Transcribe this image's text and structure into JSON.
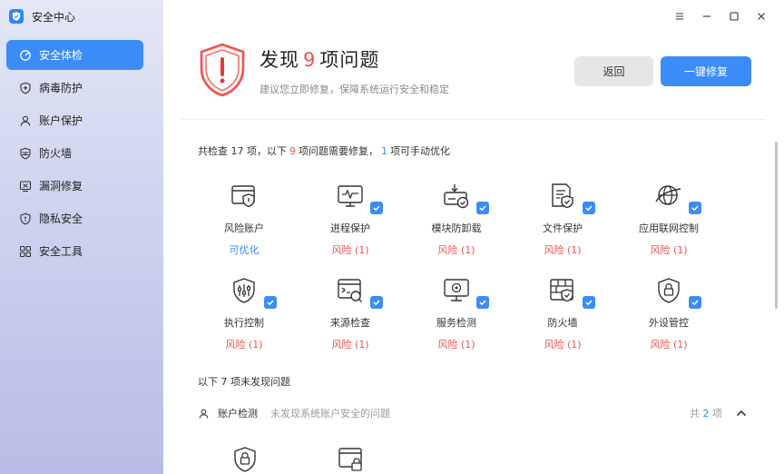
{
  "app": {
    "title": "安全中心"
  },
  "sidebar": {
    "items": [
      {
        "label": "安全体检",
        "icon": "scan-icon",
        "active": true
      },
      {
        "label": "病毒防护",
        "icon": "shield-plus-icon",
        "active": false
      },
      {
        "label": "账户保护",
        "icon": "user-icon",
        "active": false
      },
      {
        "label": "防火墙",
        "icon": "firewall-icon",
        "active": false
      },
      {
        "label": "漏洞修复",
        "icon": "bug-fix-icon",
        "active": false
      },
      {
        "label": "隐私安全",
        "icon": "privacy-shield-icon",
        "active": false
      },
      {
        "label": "安全工具",
        "icon": "tools-grid-icon",
        "active": false
      }
    ]
  },
  "window": {
    "menu": "menu-icon",
    "minimize": "minimize-icon",
    "maximize": "maximize-icon",
    "close": "close-icon"
  },
  "hero": {
    "prefix": "发现",
    "count": "9",
    "suffix": "项问题",
    "subtitle": "建议您立即修复，保障系统运行安全和稳定",
    "back_label": "返回",
    "fix_label": "一键修复"
  },
  "summary": {
    "part1": "共检查 17 项，以下",
    "issues": "9",
    "part2": "项问题需要修复，",
    "manual": "1",
    "part3": "项可手动优化"
  },
  "checks": [
    {
      "name": "风险账户",
      "status": "可优化",
      "status_type": "opt",
      "checked": false,
      "icon": "account-risk-icon"
    },
    {
      "name": "进程保护",
      "status": "风险 (1)",
      "status_type": "risk",
      "checked": true,
      "icon": "process-monitor-icon"
    },
    {
      "name": "模块防卸载",
      "status": "风险 (1)",
      "status_type": "risk",
      "checked": true,
      "icon": "module-uninstall-icon"
    },
    {
      "name": "文件保护",
      "status": "风险 (1)",
      "status_type": "risk",
      "checked": true,
      "icon": "file-protect-icon"
    },
    {
      "name": "应用联网控制",
      "status": "风险 (1)",
      "status_type": "risk",
      "checked": true,
      "icon": "network-globe-icon"
    },
    {
      "name": "执行控制",
      "status": "风险 (1)",
      "status_type": "risk",
      "checked": true,
      "icon": "exec-control-icon"
    },
    {
      "name": "来源检查",
      "status": "风险 (1)",
      "status_type": "risk",
      "checked": true,
      "icon": "source-check-icon"
    },
    {
      "name": "服务检测",
      "status": "风险 (1)",
      "status_type": "risk",
      "checked": true,
      "icon": "service-monitor-icon"
    },
    {
      "name": "防火墙",
      "status": "风险 (1)",
      "status_type": "risk",
      "checked": true,
      "icon": "firewall-shield-icon"
    },
    {
      "name": "外设管控",
      "status": "风险 (1)",
      "status_type": "risk",
      "checked": true,
      "icon": "device-lock-icon"
    }
  ],
  "no_issue": {
    "title": "以下 7 项未发现问题",
    "group_name": "账户检测",
    "group_desc": "未发现系统账户安全的问题",
    "count_prefix": "共",
    "count": "2",
    "count_suffix": "项"
  },
  "colors": {
    "accent": "#3b8cf7",
    "danger": "#f0524f"
  }
}
